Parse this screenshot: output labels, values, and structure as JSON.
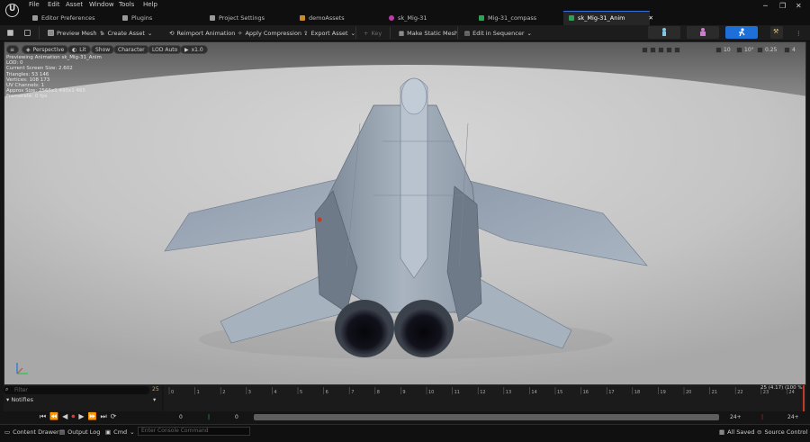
{
  "menu": [
    "File",
    "Edit",
    "Asset",
    "Window",
    "Tools",
    "Help"
  ],
  "tabs": [
    {
      "label": "Editor Preferences",
      "icon": "preferences-icon"
    },
    {
      "label": "Plugins",
      "icon": "plugins-icon"
    },
    {
      "label": "Project Settings",
      "icon": "settings-icon"
    },
    {
      "label": "demoAssets",
      "icon": "folder-icon"
    },
    {
      "label": "sk_Mig-31",
      "icon": "skeletal-mesh-icon"
    },
    {
      "label": "Mig-31_compass",
      "icon": "skeleton-icon"
    },
    {
      "label": "sk_Mig-31_Anim",
      "icon": "animation-icon"
    }
  ],
  "toolbar": {
    "preview_mesh": "Preview Mesh",
    "create_asset": "Create Asset",
    "reimport": "Reimport Animation",
    "compression": "Apply Compression",
    "export": "Export Asset",
    "key": "Key",
    "static_mesh": "Make Static Mesh",
    "sequencer": "Edit in Sequencer"
  },
  "viewport_toolbar": {
    "perspective": "Perspective",
    "lit": "Lit",
    "show": "Show",
    "character": "Character",
    "lod": "LOD Auto",
    "speed": "x1.0",
    "grid": "10",
    "angle": "10°",
    "scale": "0.25",
    "camera_speed": "4"
  },
  "stats": [
    "Previewing Animation sk_Mig-31_Anim",
    "LOD: 0",
    "Current Screen Size: 2.602",
    "Triangles: 53 146",
    "Vertices: 108 173",
    "UV Channels: 1",
    "Approx Size: 2565x1 490x1 465",
    "Framerate: 0 fps"
  ],
  "timeline": {
    "filter_placeholder": "Filter",
    "notifies": "Notifies",
    "frame_count": "25",
    "current_frame": "25 (4.17) (100 %)",
    "ticks": [
      "0",
      "1",
      "2",
      "3",
      "4",
      "5",
      "6",
      "7",
      "8",
      "9",
      "10",
      "11",
      "12",
      "13",
      "14",
      "15",
      "16",
      "17",
      "18",
      "19",
      "20",
      "21",
      "22",
      "23",
      "24",
      "25"
    ],
    "start": "0",
    "start2": "0",
    "end": "24+",
    "end2": "24+"
  },
  "statusbar": {
    "content_drawer": "Content Drawer",
    "output_log": "Output Log",
    "cmd": "Cmd",
    "cmd_placeholder": "Enter Console Command",
    "saved": "All Saved",
    "source_control": "Source Control"
  },
  "colors": {
    "accent": "#1f6fd8",
    "timeline_marker": "#c43a2a"
  }
}
